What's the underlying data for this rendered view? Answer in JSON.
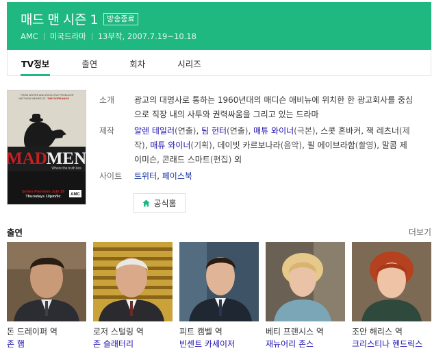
{
  "header": {
    "title": "매드 맨 시즌 1",
    "badge": "방송종료",
    "meta": [
      "AMC",
      "미국드라마",
      "13부작, 2007.7.19~10.18"
    ],
    "bg_color": "#1fb881"
  },
  "tabs": [
    {
      "label": "TV정보",
      "active": true
    },
    {
      "label": "출연",
      "active": false
    },
    {
      "label": "회차",
      "active": false
    },
    {
      "label": "시리즈",
      "active": false
    }
  ],
  "poster": {
    "top_text_1": "FROM WRITER AND EXECUTIVE PRODUCER",
    "top_text_2": "MATTHEW WEINER OF",
    "top_text_3": "THE SOPRANOS",
    "logo_mad": "MAD",
    "logo_men": "MEN",
    "tagline": "Where the truth lies",
    "premiere_1": "Series Premiere July 19",
    "premiere_2": "Thursdays 10pm/9c",
    "network": "AMC"
  },
  "info": {
    "synopsis_label": "소개",
    "synopsis": "광고의 대명사로 통하는 1960년대의 매디슨 애비뉴에 위치한 한 광고회사를 중심으로 직장 내의 사투와 권력싸움을 그리고 있는 드라마",
    "production_label": "제작",
    "production": [
      {
        "name": "알렌 테일러",
        "role": "(연출)",
        "link": true,
        "sep": ", "
      },
      {
        "name": "팀 헌터",
        "role": "(연출)",
        "link": true,
        "sep": ", "
      },
      {
        "name": "매튜 와이너",
        "role": "(극본)",
        "link": true,
        "sep": ", "
      },
      {
        "name": "스콧 혼바커",
        "role": "",
        "link": false,
        "sep": ", "
      },
      {
        "name": "잭 레츠너",
        "role": "(제작)",
        "link": false,
        "sep": ", "
      },
      {
        "name": "매튜 와이너",
        "role": "(기획)",
        "link": true,
        "sep": ", "
      },
      {
        "name": "데이빗 카르보나라",
        "role": "(음악)",
        "link": false,
        "sep": ", "
      },
      {
        "name": "필 에이브라함",
        "role": "(촬영)",
        "link": false,
        "sep": ", "
      },
      {
        "name": "말콤 제이미슨",
        "role": "",
        "link": false,
        "sep": ", "
      },
      {
        "name": "콘래드 스마트",
        "role": "(편집)",
        "link": false,
        "sep": " "
      },
      {
        "name": "외",
        "role": "",
        "link": false,
        "sep": ""
      }
    ],
    "site_label": "사이트",
    "sites": [
      "트위터",
      "페이스북"
    ],
    "site_sep": ", "
  },
  "home_button": {
    "label": "공식홈",
    "icon": "home-icon"
  },
  "cast": {
    "title": "출연",
    "more": "더보기",
    "items": [
      {
        "role": "돈 드레이퍼 역",
        "actor": "존 햄"
      },
      {
        "role": "로저 스털링 역",
        "actor": "존 슬래터리"
      },
      {
        "role": "피트 캠벨 역",
        "actor": "빈센트 카세이저"
      },
      {
        "role": "베티 프랜시스 역",
        "actor": "재뉴어리 존스"
      },
      {
        "role": "조안 해리스 역",
        "actor": "크리스티나 헨드릭스"
      }
    ]
  }
}
